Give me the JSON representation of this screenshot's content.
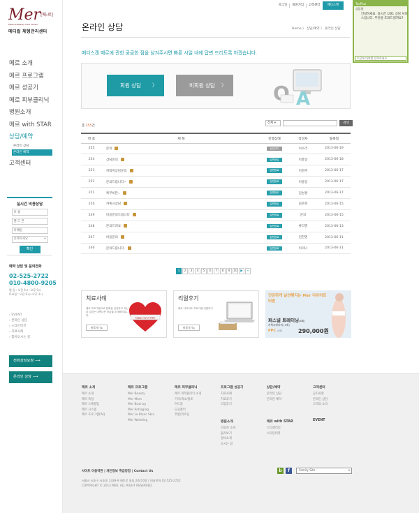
{
  "brand": {
    "mark": "Mer",
    "mark_tag": "[메:르]",
    "sub": "Medical Beauty Care Center",
    "name": "메디컬 체형관리센터"
  },
  "top_nav": [
    "로그인",
    "회원가입",
    "고객센터",
    "메디스캔"
  ],
  "sidebar": {
    "nav": [
      "메르 소개",
      "메르 프로그램",
      "메르 성공기",
      "메르 피부클리닉",
      "병원소개",
      "메르 with STAR",
      "상담/예약",
      "고객센터"
    ],
    "sub_items": [
      "온라인 상담",
      "온라인 예약"
    ],
    "realtime": {
      "title": "실시간 비용상담",
      "placeholders": [
        "이 름",
        "핸 드 폰",
        "이메일"
      ],
      "select": "선택하세요",
      "submit": "확인"
    },
    "contact": {
      "title": "예약 상담 및 문의전화",
      "phones": [
        "02-525-2722",
        "010-4800-9205"
      ],
      "hours": [
        "평  일 : 오전 9시~오후 9시",
        "토요일 : 오전 9시~오후 3시"
      ]
    },
    "quick_links": [
      "EVENT",
      "온라인 상담",
      "스타인터뷰",
      "치료사례",
      "찾아오시는 길"
    ],
    "buttons": [
      "전화상담요청",
      "온라인 상담"
    ],
    "arrow": "⟶"
  },
  "page": {
    "title": "온라인 상담",
    "breadcrumb": "Home 〉 상담/예약 〉 온라인 상담",
    "intro": "메디스캔 메르에 관한 궁금한 점을 남겨주시면 빠른 시일 내에 답변 드리도록 하겠습니다.",
    "member_button": "회원 상담",
    "guest_button": "비회원 상담",
    "arrow": "〉"
  },
  "board": {
    "count_label": "총",
    "count_value": "255",
    "count_unit": "건",
    "search_select": "전체",
    "search_button": "검색",
    "columns": [
      "번 호",
      "제 목",
      "진행상태",
      "작성자",
      "등록일"
    ],
    "rows": [
      {
        "no": "255",
        "subject": "문의",
        "status": "상담대기",
        "author": "이소리",
        "date": "2013-06-19"
      },
      {
        "no": "254",
        "subject": "상담문의",
        "status": "답변완료",
        "author": "이홍일",
        "date": "2013-06-18"
      },
      {
        "no": "253",
        "subject": "허벅지상담문의",
        "status": "답변완료",
        "author": "이경주",
        "date": "2013-06-17"
      },
      {
        "no": "252",
        "subject": "문의드립니다~",
        "status": "답변완료",
        "author": "이홍일",
        "date": "2013-06-17"
      },
      {
        "no": "251",
        "subject": "복부비만..",
        "status": "답변완료",
        "author": "김성경",
        "date": "2013-06-17"
      },
      {
        "no": "250",
        "subject": "카톡시상담",
        "status": "답변완료",
        "author": "김은희",
        "date": "2013-06-15"
      },
      {
        "no": "249",
        "subject": "비용문의드립니다",
        "status": "답변완료",
        "author": "문의",
        "date": "2013-06-15"
      },
      {
        "no": "248",
        "subject": "문의드려요",
        "status": "답변완료",
        "author": "류다영",
        "date": "2013-06-13"
      },
      {
        "no": "247",
        "subject": "비용문의",
        "status": "답변완료",
        "author": "김현영",
        "date": "2013-06-11"
      },
      {
        "no": "246",
        "subject": "문의드립니다.",
        "status": "답변완료",
        "author": "이미나",
        "date": "2013-06-11"
      }
    ],
    "pages": [
      "1",
      "2",
      "3",
      "4",
      "5",
      "6",
      "7",
      "8",
      "9",
      "10"
    ],
    "next": "▶",
    "last": "»"
  },
  "cards": [
    {
      "title": "치료사례",
      "desc": "메르 프로그램으로 변화된 건강하고 자신감 넘치는 아름다운 모습을 소개해드립니다.",
      "more": "바로가기 ▸",
      "graphic_label": "happy ever after"
    },
    {
      "title": "리얼후기",
      "desc": "메르 다이어트 프로그램 리얼후기",
      "more": "바로가기 ▸"
    }
  ],
  "promo": {
    "headline": "건강하게 날씬해지는 Mer 다이어트 비법",
    "sub": "퍼스널 트레이닝",
    "tag": "(4회)",
    "detail": "카복시테라피 (5회)",
    "ppc": "PPC",
    "ppc_tag": "(4회)",
    "price": "290,000원"
  },
  "footer": {
    "columns": [
      {
        "head": "메르 소개",
        "items": [
          "메르 소개",
          "메르 특징",
          "메르 스페셜팀",
          "메르 시스템",
          "메르 프로그램FAQ"
        ]
      },
      {
        "head": "메르 프로그램",
        "items": [
          "Mer Beauty",
          "Mer Mom",
          "Mer Bust-up",
          "Mer Antiaging",
          "Mer Le Blanc Skin",
          "Mer Wedding"
        ]
      },
      {
        "head": "메르 피부클리닉",
        "items": [
          "메르 피부클리닉 소개",
          "기미/색소/홍조",
          "여드름",
          "모공흉터",
          "주름/리프팅"
        ]
      },
      {
        "head": "프로그램 성공기",
        "items": [
          "치료사례",
          "치료후기",
          "리얼후기"
        ]
      },
      {
        "head": "상담/예약",
        "items": [
          "온라인 상담",
          "온라인 예약"
        ]
      },
      {
        "head": "고객센터",
        "items": [
          "공지사항",
          "온라인 상담",
          "고객의 소리"
        ]
      }
    ],
    "columns2": [
      {
        "head": "병원소개",
        "items": [
          "의료진 소개",
          "둘러보기",
          "장비소개",
          "오시는 길"
        ]
      },
      {
        "head": "메르 with STAR",
        "items": [
          "스타갤러리",
          "스타인터뷰"
        ]
      },
      {
        "head": "EVENT",
        "items": []
      }
    ],
    "links": [
      "사이트 이용약관",
      "개인정보 취급방침",
      "Contact Us"
    ],
    "address": "서울시 서초구 서초동 1339-9 메트로 빌딩 2층/10층 | 대표전화 02-525-2722",
    "copyright": "COPYRIGHT © 2013 MER. ALL RIGHT RESERVED.",
    "sns": [
      "b",
      "f"
    ],
    "family_site": "Family Site"
  },
  "chat": {
    "header": "TocPlus",
    "operator": "상담원",
    "message": "안녕하세요. 실시간 1대1 상담 서비스입니다. 무엇을 도와드릴까요?",
    "input_placeholder": "이곳에 대화를 입력하세요"
  },
  "colors": {
    "accent": "#1f9aa9",
    "brand": "#7a1f2b",
    "dark_teal": "#11827e",
    "chat_green": "#8bb54a"
  }
}
